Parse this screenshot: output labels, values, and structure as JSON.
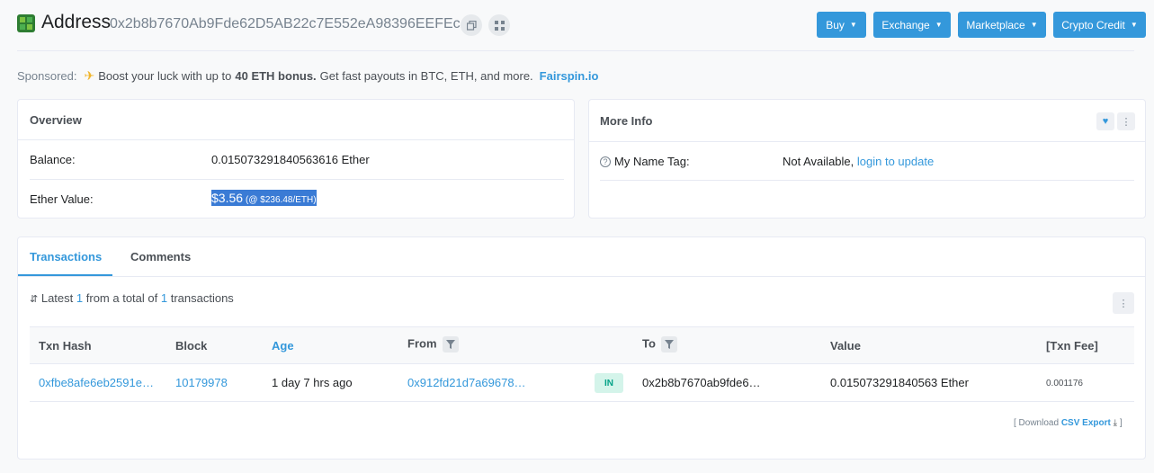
{
  "header": {
    "title": "Address",
    "address": "0x2b8b7670Ab9Fde62D5AB22c7E552eA98396EEFEc",
    "nav": [
      {
        "label": "Buy"
      },
      {
        "label": "Exchange"
      },
      {
        "label": "Marketplace"
      },
      {
        "label": "Crypto Credit"
      }
    ]
  },
  "sponsored": {
    "label": "Sponsored:",
    "text1": "Boost your luck with up to",
    "bold": "40 ETH bonus.",
    "text2": "Get fast payouts in BTC, ETH, and more.",
    "link": "Fairspin.io"
  },
  "overview": {
    "title": "Overview",
    "balance_label": "Balance:",
    "balance_value": "0.015073291840563616 Ether",
    "ether_value_label": "Ether Value:",
    "ether_value": "$3.56",
    "ether_price": "(@ $236.48/ETH)"
  },
  "more_info": {
    "title": "More Info",
    "name_tag_label": "My Name Tag:",
    "name_tag_value": "Not Available,",
    "name_tag_link": "login to update"
  },
  "tabs": [
    {
      "label": "Transactions",
      "active": true
    },
    {
      "label": "Comments",
      "active": false
    }
  ],
  "txn_summary": {
    "prefix": "Latest",
    "count": "1",
    "middle": "from a total of",
    "total": "1",
    "suffix": "transactions"
  },
  "table": {
    "headers": {
      "hash": "Txn Hash",
      "block": "Block",
      "age": "Age",
      "from": "From",
      "to": "To",
      "value": "Value",
      "fee": "[Txn Fee]"
    },
    "rows": [
      {
        "hash": "0xfbe8afe6eb2591e…",
        "block": "10179978",
        "age": "1 day 7 hrs ago",
        "from": "0x912fd21d7a69678…",
        "direction": "IN",
        "to": "0x2b8b7670ab9fde6…",
        "value": "0.015073291840563 Ether",
        "fee": "0.001176"
      }
    ]
  },
  "download": {
    "prefix": "[ Download",
    "link": "CSV Export",
    "suffix": "]"
  },
  "colors": {
    "accent": "#3498db",
    "badge_in_bg": "#d4f4ea",
    "badge_in_text": "#00a186"
  }
}
